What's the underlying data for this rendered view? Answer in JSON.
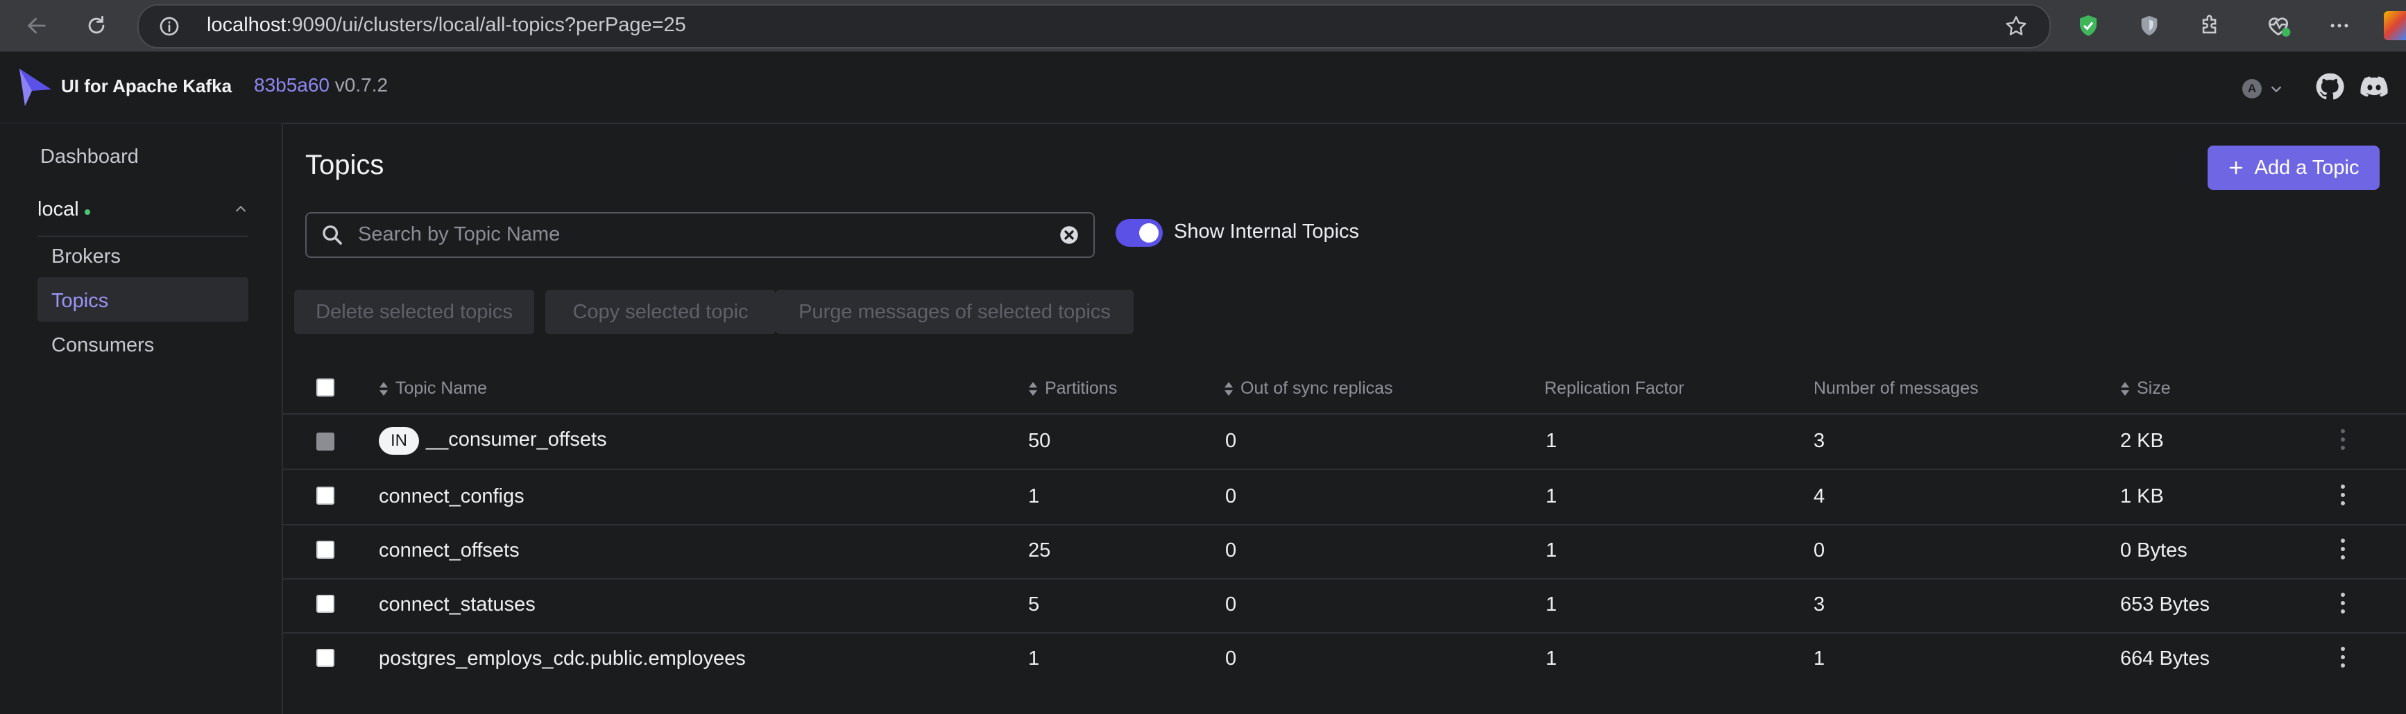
{
  "browser": {
    "url_host": "localhost",
    "url_rest": ":9090/ui/clusters/local/all-topics?perPage=25",
    "icons": [
      "back-arrow-icon",
      "reload-icon",
      "info-icon",
      "star-icon",
      "shield-check-icon",
      "shield-icon",
      "puzzle-icon",
      "heart-pulse-icon",
      "more-icon"
    ]
  },
  "header": {
    "app_title": "UI for Apache Kafka",
    "version_hash": "83b5a60",
    "version": "v0.7.2",
    "avatar_letter": "A"
  },
  "sidebar": {
    "dashboard": "Dashboard",
    "cluster": "local",
    "items": [
      "Brokers",
      "Topics",
      "Consumers"
    ],
    "active": "Topics"
  },
  "main": {
    "title": "Topics",
    "add_button": "Add a Topic",
    "search_placeholder": "Search by Topic Name",
    "show_internal_label": "Show Internal Topics",
    "show_internal_on": true,
    "bulk": {
      "delete": "Delete selected topics",
      "copy": "Copy selected topic",
      "purge": "Purge messages of selected topics"
    },
    "columns": {
      "name": "Topic Name",
      "partitions": "Partitions",
      "out_of_sync": "Out of sync replicas",
      "replication": "Replication Factor",
      "messages": "Number of messages",
      "size": "Size"
    },
    "internal_badge": "IN",
    "rows": [
      {
        "name": "__consumer_offsets",
        "partitions": "50",
        "out_of_sync": "0",
        "replication": "1",
        "messages": "3",
        "size": "2 KB"
      },
      {
        "name": "connect_configs",
        "partitions": "1",
        "out_of_sync": "0",
        "replication": "1",
        "messages": "4",
        "size": "1 KB"
      },
      {
        "name": "connect_offsets",
        "partitions": "25",
        "out_of_sync": "0",
        "replication": "1",
        "messages": "0",
        "size": "0 Bytes"
      },
      {
        "name": "connect_statuses",
        "partitions": "5",
        "out_of_sync": "0",
        "replication": "1",
        "messages": "3",
        "size": "653 Bytes"
      },
      {
        "name": "postgres_employs_cdc.public.employees",
        "partitions": "1",
        "out_of_sync": "0",
        "replication": "1",
        "messages": "1",
        "size": "664 Bytes"
      }
    ]
  },
  "colors": {
    "accent": "#6f66e3",
    "background": "#1b1c1e",
    "status_dot": "#4cc96e"
  }
}
